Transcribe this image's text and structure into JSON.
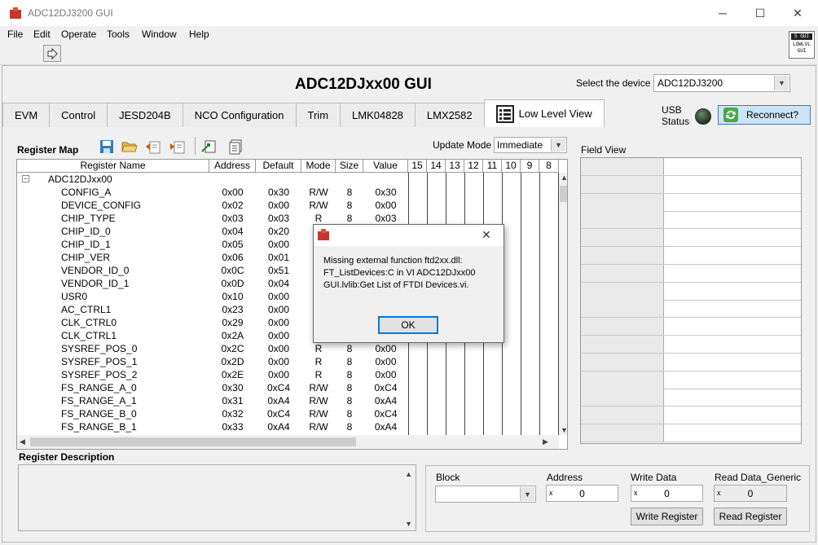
{
  "window": {
    "title": "ADC12DJ3200 GUI",
    "minimize": "─",
    "maximize": "☐",
    "close": "✕"
  },
  "menu": [
    "File",
    "Edit",
    "Operate",
    "Tools",
    "Window",
    "Help"
  ],
  "logo": {
    "line1": "S GUI",
    "line2": "LOWLVL",
    "line3": "GUI"
  },
  "header": {
    "title": "ADC12DJxx00 GUI",
    "device_label": "Select the device",
    "device_value": "ADC12DJ3200"
  },
  "tabs": [
    "EVM",
    "Control",
    "JESD204B",
    "NCO Configuration",
    "Trim",
    "LMK04828",
    "LMX2582",
    "Low Level View"
  ],
  "usb": {
    "line1": "USB",
    "line2": "Status",
    "reconnect": "Reconnect?"
  },
  "register_map": {
    "title": "Register Map",
    "update_mode_label": "Update Mode",
    "update_mode_value": "Immediate",
    "columns": [
      "Register Name",
      "Address",
      "Default",
      "Mode",
      "Size",
      "Value",
      "15",
      "14",
      "13",
      "12",
      "11",
      "10",
      "9",
      "8"
    ],
    "root": "ADC12DJxx00",
    "rows": [
      {
        "name": "CONFIG_A",
        "address": "0x00",
        "default": "0x30",
        "mode": "R/W",
        "size": "8",
        "value": "0x30"
      },
      {
        "name": "DEVICE_CONFIG",
        "address": "0x02",
        "default": "0x00",
        "mode": "R/W",
        "size": "8",
        "value": "0x00"
      },
      {
        "name": "CHIP_TYPE",
        "address": "0x03",
        "default": "0x03",
        "mode": "R",
        "size": "8",
        "value": "0x03"
      },
      {
        "name": "CHIP_ID_0",
        "address": "0x04",
        "default": "0x20",
        "mode": "",
        "size": "",
        "value": ""
      },
      {
        "name": "CHIP_ID_1",
        "address": "0x05",
        "default": "0x00",
        "mode": "",
        "size": "",
        "value": ""
      },
      {
        "name": "CHIP_VER",
        "address": "0x06",
        "default": "0x01",
        "mode": "",
        "size": "",
        "value": ""
      },
      {
        "name": "VENDOR_ID_0",
        "address": "0x0C",
        "default": "0x51",
        "mode": "",
        "size": "",
        "value": ""
      },
      {
        "name": "VENDOR_ID_1",
        "address": "0x0D",
        "default": "0x04",
        "mode": "",
        "size": "",
        "value": ""
      },
      {
        "name": "USR0",
        "address": "0x10",
        "default": "0x00",
        "mode": "R",
        "size": "",
        "value": ""
      },
      {
        "name": "AC_CTRL1",
        "address": "0x23",
        "default": "0x00",
        "mode": "R",
        "size": "",
        "value": ""
      },
      {
        "name": "CLK_CTRL0",
        "address": "0x29",
        "default": "0x00",
        "mode": "R",
        "size": "",
        "value": ""
      },
      {
        "name": "CLK_CTRL1",
        "address": "0x2A",
        "default": "0x00",
        "mode": "R",
        "size": "",
        "value": ""
      },
      {
        "name": "SYSREF_POS_0",
        "address": "0x2C",
        "default": "0x00",
        "mode": "R",
        "size": "8",
        "value": "0x00"
      },
      {
        "name": "SYSREF_POS_1",
        "address": "0x2D",
        "default": "0x00",
        "mode": "R",
        "size": "8",
        "value": "0x00"
      },
      {
        "name": "SYSREF_POS_2",
        "address": "0x2E",
        "default": "0x00",
        "mode": "R",
        "size": "8",
        "value": "0x00"
      },
      {
        "name": "FS_RANGE_A_0",
        "address": "0x30",
        "default": "0xC4",
        "mode": "R/W",
        "size": "8",
        "value": "0xC4"
      },
      {
        "name": "FS_RANGE_A_1",
        "address": "0x31",
        "default": "0xA4",
        "mode": "R/W",
        "size": "8",
        "value": "0xA4"
      },
      {
        "name": "FS_RANGE_B_0",
        "address": "0x32",
        "default": "0xC4",
        "mode": "R/W",
        "size": "8",
        "value": "0xC4"
      },
      {
        "name": "FS_RANGE_B_1",
        "address": "0x33",
        "default": "0xA4",
        "mode": "R/W",
        "size": "8",
        "value": "0xA4"
      }
    ]
  },
  "field_view": {
    "title": "Field View"
  },
  "register_description": {
    "title": "Register Description"
  },
  "rw": {
    "block_label": "Block",
    "address_label": "Address",
    "address_value": "0",
    "address_radix": "x",
    "write_label": "Write Data",
    "write_value": "0",
    "write_radix": "x",
    "read_label": "Read Data_Generic",
    "read_value": "0",
    "read_radix": "x",
    "write_button": "Write Register",
    "read_button": "Read Register"
  },
  "dialog": {
    "message_line1": "Missing external function ftd2xx.dll:",
    "message_line2": "FT_ListDevices:C in VI ADC12DJxx00",
    "message_line3": "GUI.lvlib:Get List of FTDI Devices.vi.",
    "ok": "OK"
  },
  "colors": {
    "accent": "#0078d7",
    "reconnect_bg": "#cde4f7",
    "icon_red": "#c0392b"
  }
}
